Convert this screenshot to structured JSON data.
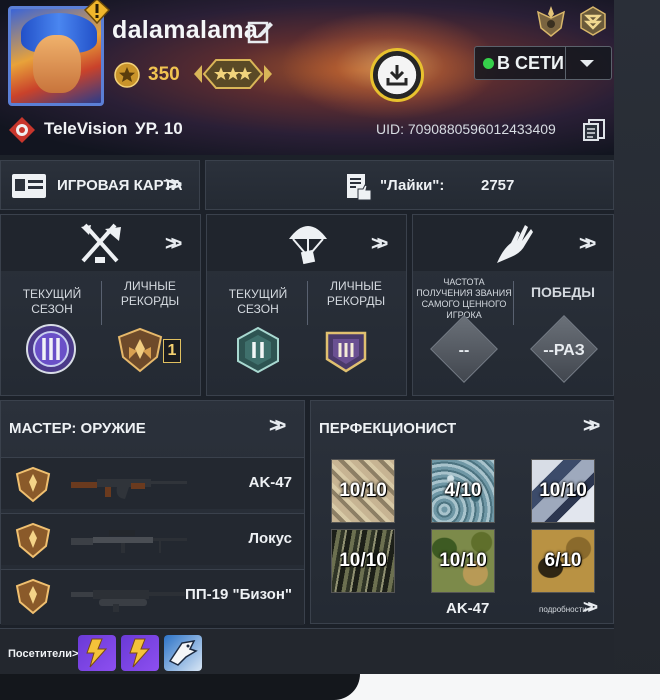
{
  "profile": {
    "username": "dalamalama",
    "coins": "350",
    "clan": "TeleVision",
    "level": "УР. 10",
    "uid": "UID: 7090880596012433409",
    "status": "В СЕТИ"
  },
  "buttons": {
    "card": "ИГРОВАЯ КАРТА",
    "likes_label": "\"Лайки\":",
    "likes_value": "2757"
  },
  "modes": [
    {
      "left_label": "ТЕКУЩИЙ СЕЗОН",
      "right_label": "ЛИЧНЫЕ РЕКОРДЫ",
      "record_value": "1"
    },
    {
      "left_label": "ТЕКУЩИЙ СЕЗОН",
      "right_label": "ЛИЧНЫЕ РЕКОРДЫ"
    },
    {
      "left_label": "ЧАСТОТА ПОЛУЧЕНИЯ ЗВАНИЯ САМОГО ЦЕННОГО ИГРОКА",
      "right_label": "ПОБЕДЫ",
      "mvp_value": "--",
      "wins_value": "--РАЗ"
    }
  ],
  "weapon_master": {
    "title": "МАСТЕР: ОРУЖИЕ",
    "weapons": [
      "AK-47",
      "Локус",
      "ПП-19 \"Бизон\""
    ]
  },
  "perfectionist": {
    "title": "ПЕРФЕКЦИОНИСТ",
    "tiles": [
      "10/10",
      "4/10",
      "10/10",
      "10/10",
      "10/10",
      "6/10"
    ],
    "weapon": "AK-47",
    "details": "подробности"
  },
  "visitors": {
    "label": "Посетители>"
  },
  "colors": {
    "accent_gold": "#f1c451",
    "online_green": "#36d04b",
    "panel_bg": "#2b313b"
  }
}
